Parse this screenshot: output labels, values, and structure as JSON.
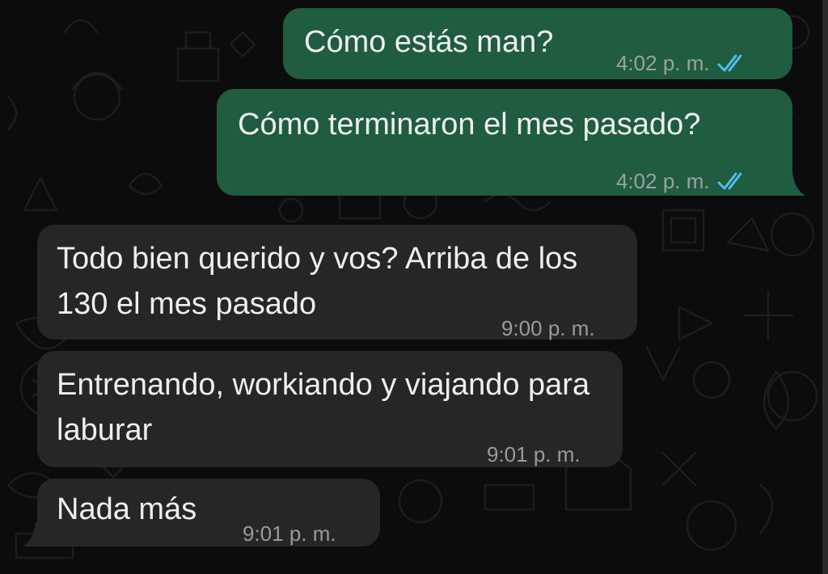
{
  "messages": [
    {
      "direction": "outgoing",
      "text": "Cómo estás man?",
      "time": "4:02 p. m.",
      "status_icon": "double-check-read-icon"
    },
    {
      "direction": "outgoing",
      "text": "Cómo terminaron el mes pasado?",
      "time": "4:02 p. m.",
      "status_icon": "double-check-read-icon"
    },
    {
      "direction": "incoming",
      "text": "Todo bien querido y vos? Arriba de los 130 el mes pasado",
      "time": "9:00 p. m."
    },
    {
      "direction": "incoming",
      "text": "Entrenando, workiando y viajando para laburar",
      "time": "9:01 p. m."
    },
    {
      "direction": "incoming",
      "text": "Nada más",
      "time": "9:01 p. m."
    }
  ],
  "colors": {
    "outgoing_bubble": "#1f5c40",
    "incoming_bubble": "#262626",
    "read_ticks": "#53bdeb",
    "background": "#0c0c0c"
  }
}
